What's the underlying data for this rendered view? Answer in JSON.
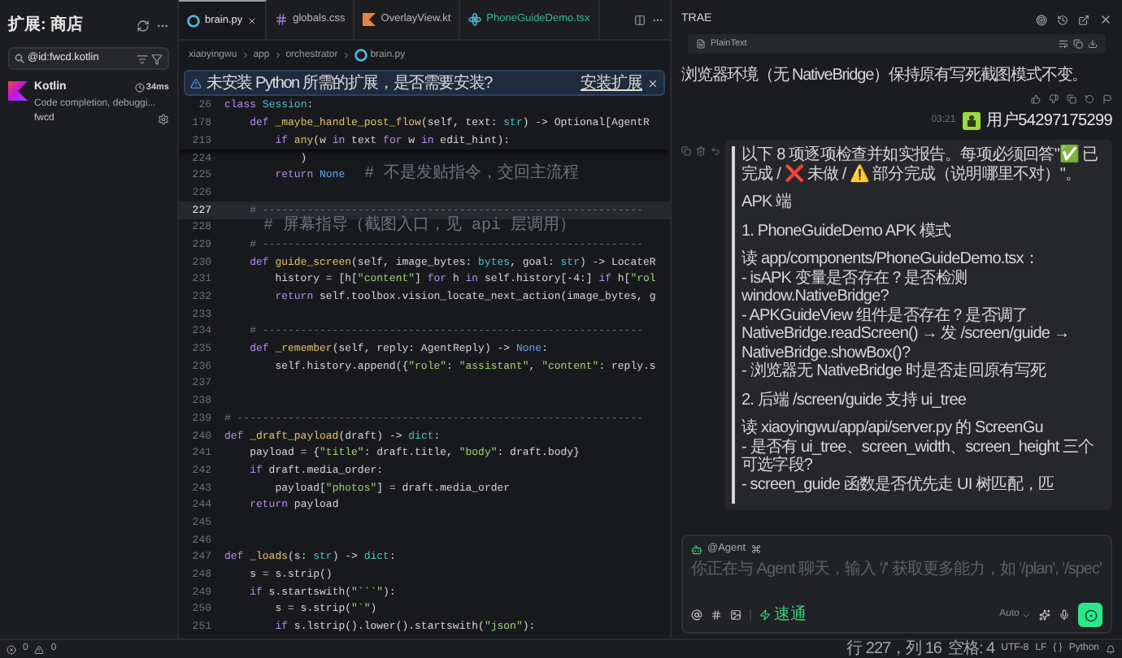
{
  "sidebar": {
    "title": "扩展: 商店",
    "search": {
      "value": "@id:fwcd.kotlin"
    },
    "extensions": [
      {
        "name": "Kotlin",
        "time": "34ms",
        "description": "Code completion, debuggi...",
        "publisher": "fwcd"
      }
    ]
  },
  "editor": {
    "tabs": [
      {
        "label": "brain.py",
        "kind": "python",
        "selected": true,
        "color": "#e6e6e6"
      },
      {
        "label": "globals.css",
        "kind": "css",
        "selected": false,
        "color": "#b8b8b8"
      },
      {
        "label": "OverlayView.kt",
        "kind": "kotlin",
        "selected": false,
        "color": "#b8b8b8"
      },
      {
        "label": "PhoneGuideDemo.tsx",
        "kind": "react",
        "selected": false,
        "color": "#3bb89a"
      }
    ],
    "breadcrumb": [
      "xiaoyingwu",
      "app",
      "orchestrator",
      "brain.py"
    ],
    "notification": {
      "message": "未安装 Python 所需的扩展，是否需要安装?",
      "action": "安装扩展"
    },
    "sticky_lines": [
      {
        "number": "26",
        "tokens": [
          {
            "kind": "keyword",
            "text": "class"
          },
          {
            "kind": "type",
            "text": " Session"
          },
          {
            "kind": "plain",
            "text": ":"
          }
        ]
      },
      {
        "number": "178",
        "tokens": [
          {
            "kind": "keyword",
            "text": "    def"
          },
          {
            "kind": "function",
            "text": " _maybe_handle_post_flow"
          },
          {
            "kind": "plain",
            "text": "(self, text: "
          },
          {
            "kind": "type",
            "text": "str"
          },
          {
            "kind": "plain",
            "text": ") -> Optional[AgentR"
          }
        ]
      },
      {
        "number": "213",
        "tokens": [
          {
            "kind": "keyword",
            "text": "        if"
          },
          {
            "kind": "function",
            "text": " any"
          },
          {
            "kind": "plain",
            "text": "(w "
          },
          {
            "kind": "keyword",
            "text": "in"
          },
          {
            "kind": "plain",
            "text": " text "
          },
          {
            "kind": "keyword",
            "text": "for"
          },
          {
            "kind": "plain",
            "text": " w "
          },
          {
            "kind": "keyword",
            "text": "in"
          },
          {
            "kind": "plain",
            "text": " edit_hint):"
          }
        ]
      }
    ],
    "lines": [
      {
        "number": "224",
        "current": false,
        "tokens": [
          {
            "kind": "plain",
            "text": "            )"
          }
        ]
      },
      {
        "number": "225",
        "current": false,
        "tokens": [
          {
            "kind": "keyword",
            "text": "        return"
          },
          {
            "kind": "constant",
            "text": " None"
          },
          {
            "kind": "comment",
            "text": "  # 不是发贴指令，交回主流程"
          }
        ]
      },
      {
        "number": "226",
        "current": false
      },
      {
        "number": "227",
        "current": true,
        "tokens": [
          {
            "kind": "comment",
            "text": "    # ------------------------------------------------------------"
          }
        ]
      },
      {
        "number": "228",
        "current": false,
        "tokens": [
          {
            "kind": "comment",
            "text": "    # 屏幕指导（截图入口，见 api 层调用）"
          }
        ]
      },
      {
        "number": "229",
        "current": false,
        "tokens": [
          {
            "kind": "comment",
            "text": "    # ------------------------------------------------------------"
          }
        ]
      },
      {
        "number": "230",
        "current": false,
        "tokens": [
          {
            "kind": "keyword",
            "text": "    def"
          },
          {
            "kind": "function",
            "text": " guide_screen"
          },
          {
            "kind": "plain",
            "text": "(self, image_bytes: "
          },
          {
            "kind": "type",
            "text": "bytes"
          },
          {
            "kind": "plain",
            "text": ", goal: "
          },
          {
            "kind": "type",
            "text": "str"
          },
          {
            "kind": "plain",
            "text": ") -> LocateR"
          }
        ]
      },
      {
        "number": "231",
        "current": false,
        "tokens": [
          {
            "kind": "plain",
            "text": "        history = [h["
          },
          {
            "kind": "string",
            "text": "\"content\""
          },
          {
            "kind": "plain",
            "text": "] "
          },
          {
            "kind": "keyword",
            "text": "for"
          },
          {
            "kind": "plain",
            "text": " h "
          },
          {
            "kind": "keyword",
            "text": "in"
          },
          {
            "kind": "plain",
            "text": " self.history[-4:] "
          },
          {
            "kind": "keyword",
            "text": "if"
          },
          {
            "kind": "plain",
            "text": " h["
          },
          {
            "kind": "string",
            "text": "\"rol"
          }
        ]
      },
      {
        "number": "232",
        "current": false,
        "tokens": [
          {
            "kind": "keyword",
            "text": "        return"
          },
          {
            "kind": "plain",
            "text": " self.toolbox.vision_locate_next_action(image_bytes, g"
          }
        ]
      },
      {
        "number": "233",
        "current": false
      },
      {
        "number": "234",
        "current": false,
        "tokens": [
          {
            "kind": "comment",
            "text": "    # ------------------------------------------------------------"
          }
        ]
      },
      {
        "number": "235",
        "current": false,
        "tokens": [
          {
            "kind": "keyword",
            "text": "    def"
          },
          {
            "kind": "function",
            "text": " _remember"
          },
          {
            "kind": "plain",
            "text": "(self, reply: AgentReply) -> "
          },
          {
            "kind": "constant",
            "text": "None"
          },
          {
            "kind": "plain",
            "text": ":"
          }
        ]
      },
      {
        "number": "236",
        "current": false,
        "tokens": [
          {
            "kind": "plain",
            "text": "        self.history.append({"
          },
          {
            "kind": "string",
            "text": "\"role\""
          },
          {
            "kind": "plain",
            "text": ": "
          },
          {
            "kind": "string",
            "text": "\"assistant\""
          },
          {
            "kind": "plain",
            "text": ", "
          },
          {
            "kind": "string",
            "text": "\"content\""
          },
          {
            "kind": "plain",
            "text": ": reply.s"
          }
        ]
      },
      {
        "number": "237",
        "current": false
      },
      {
        "number": "238",
        "current": false
      },
      {
        "number": "239",
        "current": false,
        "tokens": [
          {
            "kind": "comment",
            "text": "# ----------------------------------------------------------------"
          }
        ]
      },
      {
        "number": "240",
        "current": false,
        "tokens": [
          {
            "kind": "keyword",
            "text": "def"
          },
          {
            "kind": "function",
            "text": " _draft_payload"
          },
          {
            "kind": "plain",
            "text": "(draft) -> "
          },
          {
            "kind": "type",
            "text": "dict"
          },
          {
            "kind": "plain",
            "text": ":"
          }
        ]
      },
      {
        "number": "241",
        "current": false,
        "tokens": [
          {
            "kind": "plain",
            "text": "    payload = {"
          },
          {
            "kind": "string",
            "text": "\"title\""
          },
          {
            "kind": "plain",
            "text": ": draft.title, "
          },
          {
            "kind": "string",
            "text": "\"body\""
          },
          {
            "kind": "plain",
            "text": ": draft.body}"
          }
        ]
      },
      {
        "number": "242",
        "current": false,
        "tokens": [
          {
            "kind": "keyword",
            "text": "    if"
          },
          {
            "kind": "plain",
            "text": " draft.media_order:"
          }
        ]
      },
      {
        "number": "243",
        "current": false,
        "tokens": [
          {
            "kind": "plain",
            "text": "        payload["
          },
          {
            "kind": "string",
            "text": "\"photos\""
          },
          {
            "kind": "plain",
            "text": "] = draft.media_order"
          }
        ]
      },
      {
        "number": "244",
        "current": false,
        "tokens": [
          {
            "kind": "keyword",
            "text": "    return"
          },
          {
            "kind": "plain",
            "text": " payload"
          }
        ]
      },
      {
        "number": "245",
        "current": false
      },
      {
        "number": "246",
        "current": false
      },
      {
        "number": "247",
        "current": false,
        "tokens": [
          {
            "kind": "keyword",
            "text": "def"
          },
          {
            "kind": "function",
            "text": " _loads"
          },
          {
            "kind": "plain",
            "text": "(s: "
          },
          {
            "kind": "type",
            "text": "str"
          },
          {
            "kind": "plain",
            "text": ") -> "
          },
          {
            "kind": "type",
            "text": "dict"
          },
          {
            "kind": "plain",
            "text": ":"
          }
        ]
      },
      {
        "number": "248",
        "current": false,
        "tokens": [
          {
            "kind": "plain",
            "text": "    s = s.strip()"
          }
        ]
      },
      {
        "number": "249",
        "current": false,
        "tokens": [
          {
            "kind": "keyword",
            "text": "    if"
          },
          {
            "kind": "plain",
            "text": " s.startswith("
          },
          {
            "kind": "string",
            "text": "\"```\""
          },
          {
            "kind": "plain",
            "text": "):"
          }
        ]
      },
      {
        "number": "250",
        "current": false,
        "tokens": [
          {
            "kind": "plain",
            "text": "        s = s.strip("
          },
          {
            "kind": "string",
            "text": "\"`\""
          },
          {
            "kind": "plain",
            "text": ")"
          }
        ]
      },
      {
        "number": "251",
        "current": false,
        "tokens": [
          {
            "kind": "keyword",
            "text": "        if"
          },
          {
            "kind": "plain",
            "text": " s.lstrip().lower().startswith("
          },
          {
            "kind": "string",
            "text": "\"json\""
          },
          {
            "kind": "plain",
            "text": "):"
          }
        ]
      }
    ]
  },
  "chat": {
    "title": "TRAE",
    "code_block": {
      "language": "PlainText"
    },
    "assistant_message": "浏览器环境（无 NativeBridge）保持原有写死截图模式不变。",
    "user": {
      "time": "03:21",
      "name": "用户54297175299"
    },
    "user_message": [
      {
        "kind": "text",
        "text": "以下 8 项逐项检查并如实报告。每项必须回答\"✅ 已完成 / ❌ 未做 / ⚠️ 部分完成（说明哪里不对）\"。"
      },
      {
        "kind": "blank"
      },
      {
        "kind": "text",
        "text": "APK 端"
      },
      {
        "kind": "blank"
      },
      {
        "kind": "text",
        "text": "1. PhoneGuideDemo APK 模式"
      },
      {
        "kind": "blank"
      },
      {
        "kind": "text",
        "text": "读 app/components/PhoneGuideDemo.tsx："
      },
      {
        "kind": "text",
        "text": "- isAPK 变量是否存在？是否检测 window.NativeBridge?"
      },
      {
        "kind": "text",
        "text": "- APKGuideView 组件是否存在？是否调了 NativeBridge.readScreen() → 发 /screen/guide → NativeBridge.showBox()?"
      },
      {
        "kind": "text",
        "text": "- 浏览器无 NativeBridge 时是否走回原有写死"
      },
      {
        "kind": "blank"
      },
      {
        "kind": "text",
        "text": "2. 后端 /screen/guide 支持 ui_tree"
      },
      {
        "kind": "blank"
      },
      {
        "kind": "text",
        "text": "读 xiaoyingwu/app/api/server.py 的 ScreenGu"
      },
      {
        "kind": "text",
        "text": "- 是否有 ui_tree、screen_width、screen_height 三个可选字段?"
      },
      {
        "kind": "text",
        "text": "- screen_guide 函数是否优先走 UI 树匹配，匹"
      },
      {
        "kind": "blank"
      }
    ],
    "input": {
      "agent": "@Agent",
      "placeholder": "你正在与 Agent 聊天，输入 '/' 获取更多能力，如 '/plan', '/spec'",
      "mode": "速通",
      "model": "Auto"
    }
  },
  "status_bar": {
    "errors": "0",
    "warnings": "0",
    "items": [
      "行 227，列 16",
      "空格: 4",
      "UTF-8",
      "LF",
      "{ }",
      "Python"
    ]
  }
}
